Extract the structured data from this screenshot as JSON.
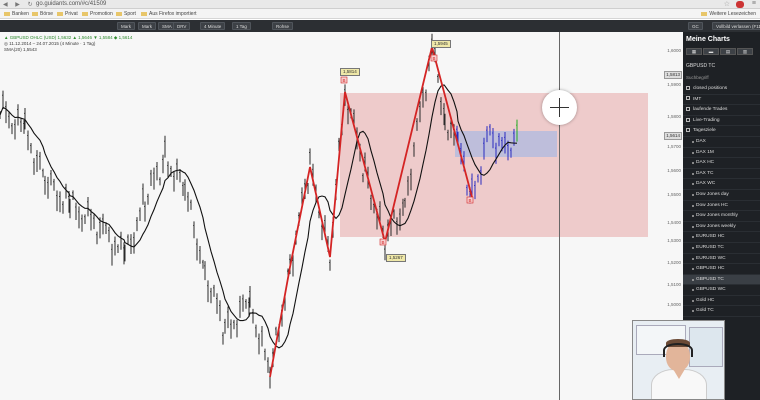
{
  "browser": {
    "nav_glyphs": "◀ ▶ ↻",
    "url": "go.guidants.com/#c/41509",
    "star_glyph": "☆",
    "menu_glyph": "≡",
    "bookmarks": [
      "Banken",
      "Börse",
      "Privat",
      "Promotion",
      "Sport",
      "Aus Firefox importiert"
    ],
    "other_bookmarks": "Weitere Lesezeichen"
  },
  "toolbar": {
    "left_buttons": [
      "Mark",
      "Mark",
      "SMA",
      "DRV"
    ],
    "timeframe": "4 Minute",
    "period": "1 Tag",
    "mode": "Rohse",
    "right_buttons": [
      "GC",
      "Vollbild verlassen (F11)"
    ]
  },
  "chart": {
    "legend_line1": "▲ GBPUSD OHLC (USD) 1,5632 ▲ 1,5646 ▼ 1,5584 ◆ 1,5614",
    "legend_line2": "◎ 11.12.2014 – 24.07.2015 (4 Minute · 1 Tag)",
    "legend_line3": "SMA(20) 1,5543",
    "price_labels": [
      {
        "id": "high",
        "text": "1,5945"
      },
      {
        "id": "first-peak",
        "text": "1,5814"
      },
      {
        "id": "low",
        "text": "1,5267"
      },
      {
        "id": "crosshair",
        "text": "1,5813"
      },
      {
        "id": "current",
        "text": "1,5614"
      }
    ],
    "y_ticks": [
      "1,6000",
      "1,5900",
      "1,5800",
      "1,5700",
      "1,5600",
      "1,5500",
      "1,5400",
      "1,5300",
      "1,5200",
      "1,5100",
      "1,5000",
      "1,4900"
    ],
    "markers": [
      "B",
      "B",
      "B",
      "B"
    ],
    "colors": {
      "up_candle": "#2a2a2a",
      "zigzag": "#d42424",
      "sma_line": "#111111",
      "zone_red": "#e8a8a8",
      "zone_blue": "#9fb5e6",
      "tail_candle": "#2b2bbf",
      "last_candle": "#22aa22"
    }
  },
  "sidebar": {
    "title": "Meine Charts",
    "buttons": [
      "▦",
      "▬",
      "▤",
      "▥"
    ],
    "current_chart": "GBPUSD TC",
    "search": "Suchbegriff",
    "items": [
      {
        "label": "closed positions",
        "type": "folder"
      },
      {
        "label": "IMT",
        "type": "folder"
      },
      {
        "label": "laufende Trades",
        "type": "folder"
      },
      {
        "label": "Live-Trading",
        "type": "folder"
      },
      {
        "label": "Tagesziele",
        "type": "folder"
      },
      {
        "label": "DAX",
        "type": "chart"
      },
      {
        "label": "DAX 1M",
        "type": "chart"
      },
      {
        "label": "DAX HC",
        "type": "chart"
      },
      {
        "label": "DAX TC",
        "type": "chart"
      },
      {
        "label": "DAX WC",
        "type": "chart"
      },
      {
        "label": "Dow Jones day",
        "type": "chart"
      },
      {
        "label": "Dow Jones HC",
        "type": "chart"
      },
      {
        "label": "Dow Jones monthly",
        "type": "chart"
      },
      {
        "label": "Dow Jones weekly",
        "type": "chart"
      },
      {
        "label": "EURUSD HC",
        "type": "chart"
      },
      {
        "label": "EURUSD TC",
        "type": "chart"
      },
      {
        "label": "EURUSD WC",
        "type": "chart"
      },
      {
        "label": "GBPUSD HC",
        "type": "chart"
      },
      {
        "label": "GBPUSD TC",
        "type": "chart",
        "selected": true
      },
      {
        "label": "GBPUSD WC",
        "type": "chart"
      },
      {
        "label": "Gold HC",
        "type": "chart"
      },
      {
        "label": "Gold TC",
        "type": "chart"
      }
    ]
  }
}
